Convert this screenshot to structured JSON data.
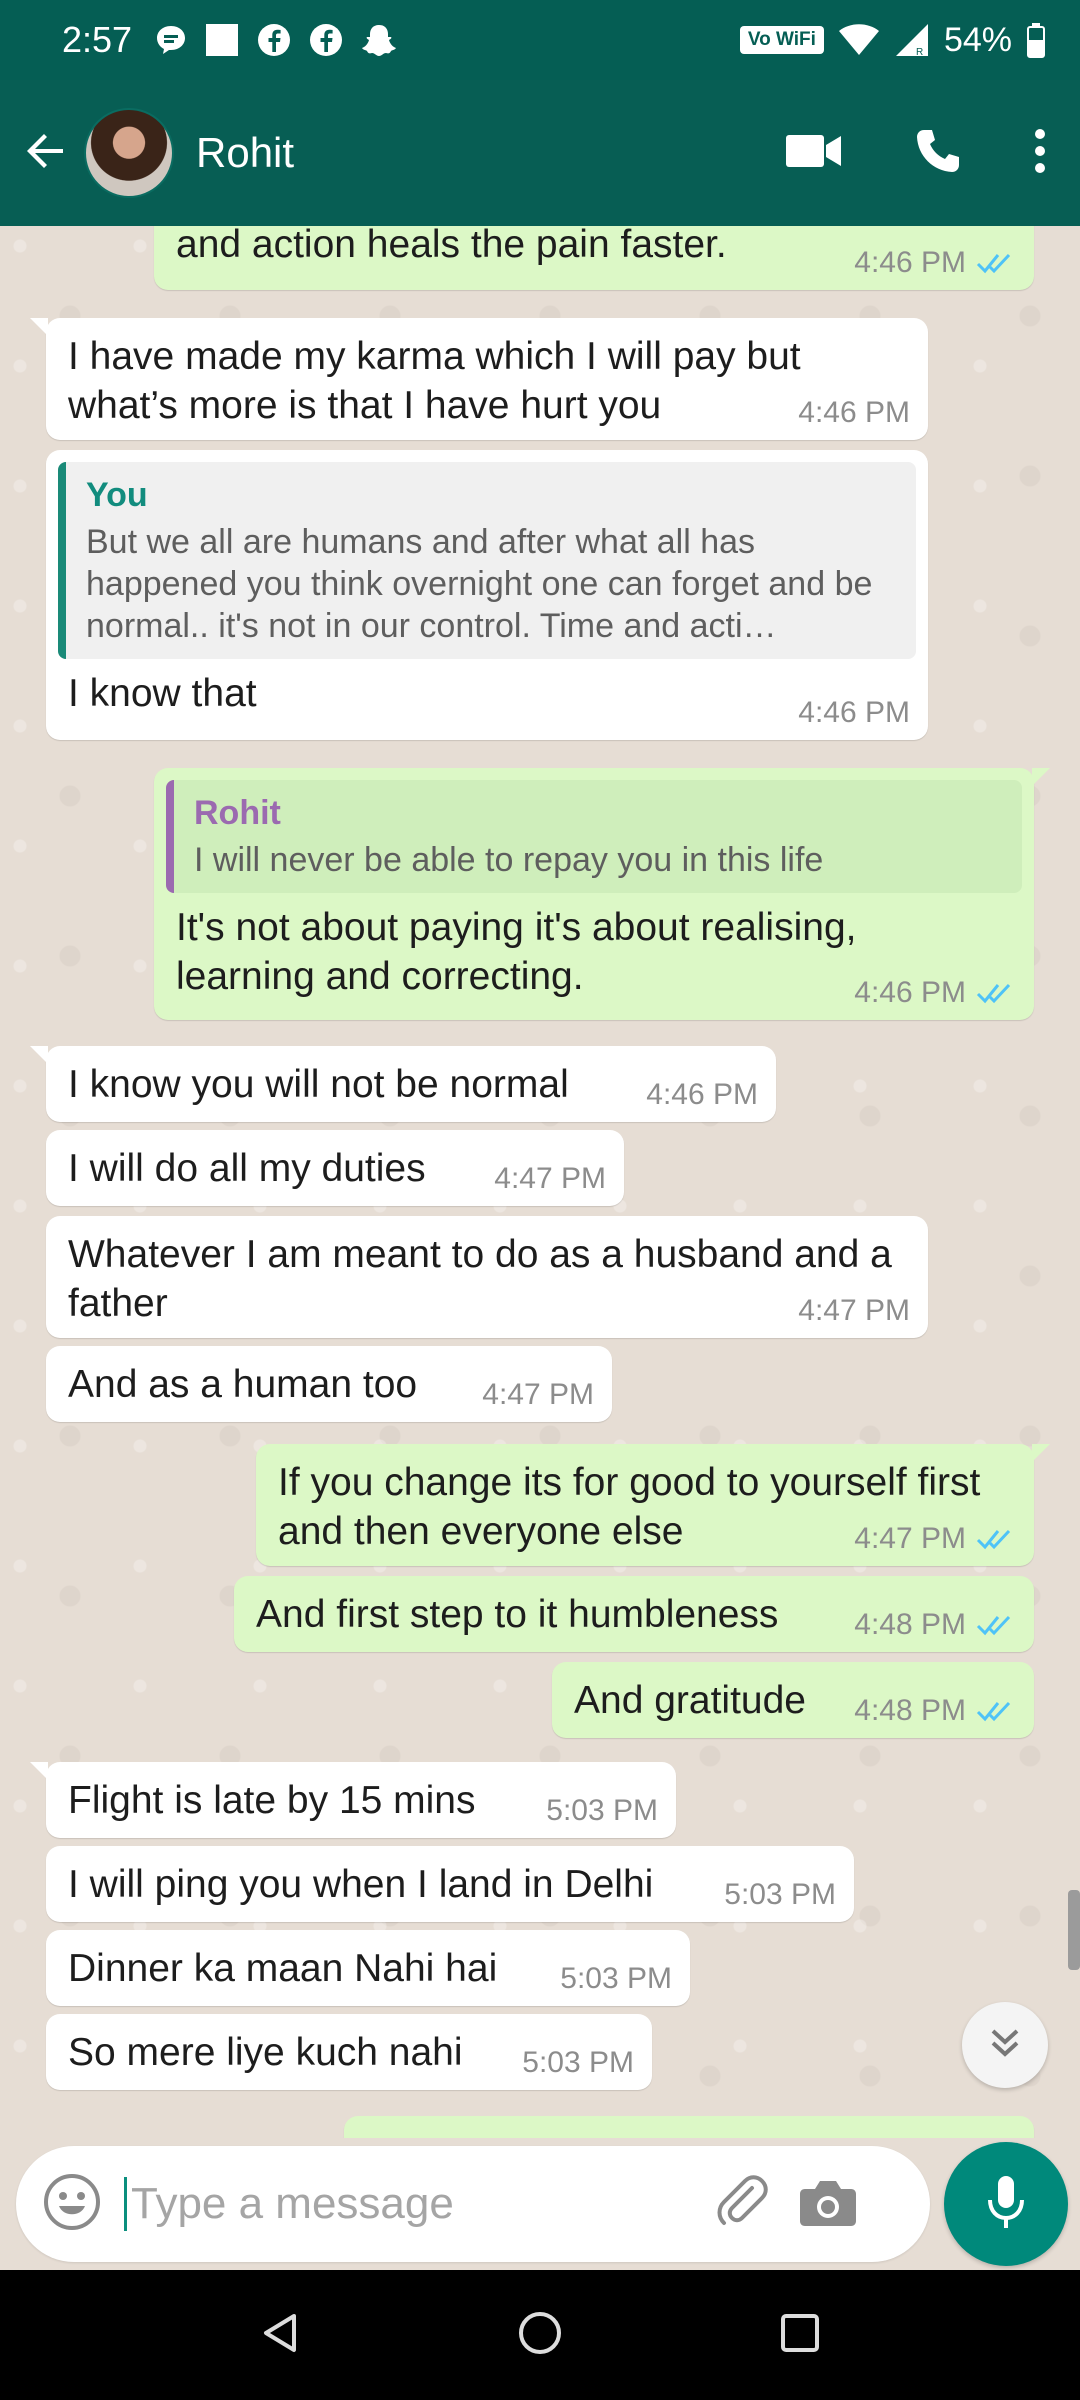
{
  "status_bar": {
    "time": "2:57",
    "vowifi": "Vo WiFi",
    "battery": "54%"
  },
  "header": {
    "contact_name": "Rohit",
    "icons": [
      "back-arrow-icon",
      "video-call-icon",
      "phone-icon",
      "more-options-icon"
    ]
  },
  "messages": [
    {
      "id": 0,
      "dir": "out",
      "text": "and action heals the pain faster.",
      "time": "4:46 PM",
      "read": true
    },
    {
      "id": 1,
      "dir": "in",
      "text": "I have made my karma which I will pay but what’s more is that I have hurt you",
      "time": "4:46 PM"
    },
    {
      "id": 2,
      "dir": "in",
      "quote_author": "You",
      "quote_text": "But we all are humans and after what all has happened you think overnight one can forget and be normal.. it's not in our control. Time and acti…",
      "text": "I know that",
      "time": "4:46 PM"
    },
    {
      "id": 3,
      "dir": "out",
      "quote_author": "Rohit",
      "quote_text": "I will never be able to repay you in this life",
      "text": "It's not about paying it's about realising, learning and correcting.",
      "time": "4:46 PM",
      "read": true
    },
    {
      "id": 4,
      "dir": "in",
      "text": "I know you will not be normal",
      "time": "4:46 PM"
    },
    {
      "id": 5,
      "dir": "in",
      "text": "I will do all my duties",
      "time": "4:47 PM"
    },
    {
      "id": 6,
      "dir": "in",
      "text": "Whatever I am meant to do as a husband and a father",
      "time": "4:47 PM"
    },
    {
      "id": 7,
      "dir": "in",
      "text": "And as a human too",
      "time": "4:47 PM"
    },
    {
      "id": 8,
      "dir": "out",
      "text": "If you change its for good to yourself first and then everyone else",
      "time": "4:47 PM",
      "read": true
    },
    {
      "id": 9,
      "dir": "out",
      "text": "And first step to it humbleness",
      "time": "4:48 PM",
      "read": true
    },
    {
      "id": 10,
      "dir": "out",
      "text": "And gratitude",
      "time": "4:48 PM",
      "read": true
    },
    {
      "id": 11,
      "dir": "in",
      "text": "Flight is late by 15 mins",
      "time": "5:03 PM"
    },
    {
      "id": 12,
      "dir": "in",
      "text": "I will ping you when I land in Delhi",
      "time": "5:03 PM"
    },
    {
      "id": 13,
      "dir": "in",
      "text": "Dinner ka maan Nahi hai",
      "time": "5:03 PM"
    },
    {
      "id": 14,
      "dir": "in",
      "text": "So mere liye kuch nahi",
      "time": "5:03 PM"
    }
  ],
  "composer": {
    "placeholder": "Type a message"
  },
  "colors": {
    "header": "#075e54",
    "status_bar": "#055e54",
    "outgoing_bubble": "#dcf8c6",
    "incoming_bubble": "#ffffff",
    "read_ticks": "#4fc3f7",
    "mic_button": "#00897b"
  }
}
